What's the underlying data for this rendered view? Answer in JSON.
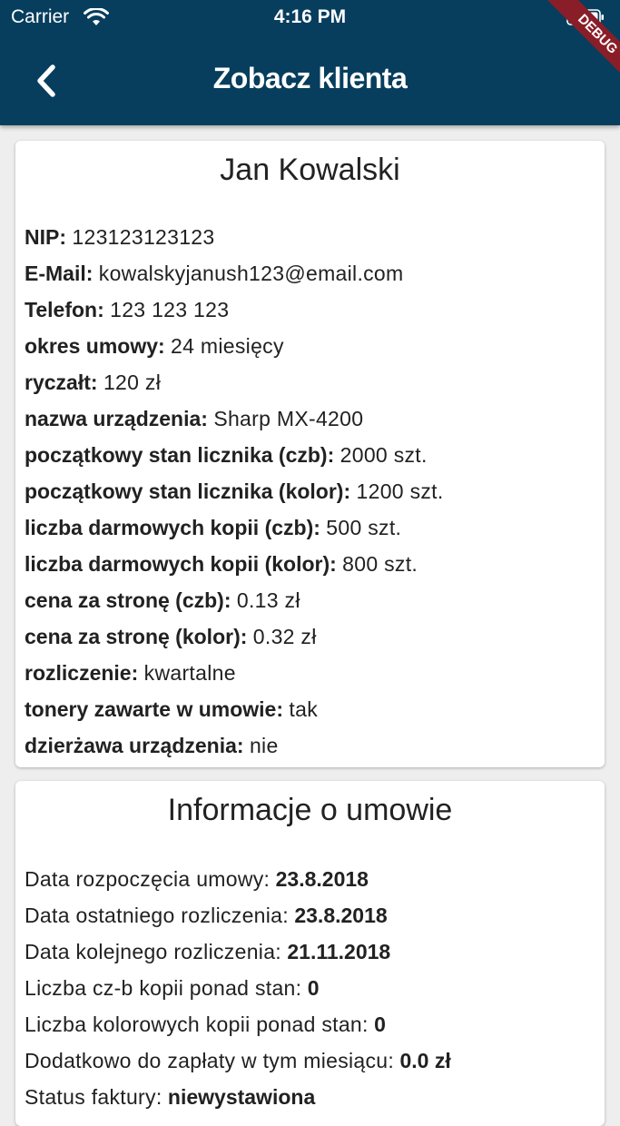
{
  "status_bar": {
    "carrier": "Carrier",
    "time": "4:16 PM"
  },
  "header": {
    "title": "Zobacz klienta",
    "back_icon": "chevron-left-icon",
    "debug_label": "DEBUG"
  },
  "client": {
    "name": "Jan Kowalski",
    "fields": [
      {
        "label": "NIP:",
        "value": "123123123123"
      },
      {
        "label": "E-Mail:",
        "value": "kowalskyjanush123@email.com"
      },
      {
        "label": "Telefon:",
        "value": "123 123 123"
      },
      {
        "label": "okres umowy:",
        "value": "24 miesięcy"
      },
      {
        "label": "ryczałt:",
        "value": "120 zł"
      },
      {
        "label": "nazwa urządzenia:",
        "value": "Sharp MX-4200"
      },
      {
        "label": "początkowy stan licznika (czb):",
        "value": "2000 szt."
      },
      {
        "label": "początkowy stan licznika (kolor):",
        "value": "1200 szt."
      },
      {
        "label": "liczba darmowych kopii (czb):",
        "value": "500 szt."
      },
      {
        "label": "liczba darmowych kopii (kolor):",
        "value": "800 szt."
      },
      {
        "label": "cena za stronę (czb):",
        "value": "0.13 zł"
      },
      {
        "label": "cena za stronę (kolor):",
        "value": "0.32 zł"
      },
      {
        "label": "rozliczenie:",
        "value": "kwartalne"
      },
      {
        "label": "tonery zawarte w umowie:",
        "value": "tak"
      },
      {
        "label": "dzierżawa urządzenia:",
        "value": "nie"
      }
    ]
  },
  "contract": {
    "title": "Informacje o umowie",
    "fields": [
      {
        "label": "Data rozpoczęcia umowy:",
        "value": "23.8.2018"
      },
      {
        "label": "Data ostatniego rozliczenia:",
        "value": "23.8.2018"
      },
      {
        "label": "Data kolejnego rozliczenia:",
        "value": "21.11.2018"
      },
      {
        "label": "Liczba cz-b kopii ponad stan:",
        "value": "0"
      },
      {
        "label": "Liczba kolorowych kopii ponad stan:",
        "value": "0"
      },
      {
        "label": "Dodatkowo do zapłaty w tym miesiącu:",
        "value": "0.0 zł"
      },
      {
        "label": "Status faktury:",
        "value": "niewystawiona"
      }
    ]
  }
}
